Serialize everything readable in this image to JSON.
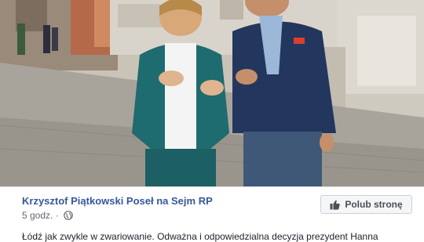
{
  "post": {
    "author": "Krzysztof Piątkowski Poseł na Sejm RP",
    "time": "5 godz. ·",
    "privacy_icon": "globe-icon",
    "like_button_label": "Polub stronę",
    "like_icon": "thumbs-up-icon",
    "text": "Łódź jak zwykle w zwariowanie. Odważna i odpowiedzialna decyzja prezydent Hanna"
  },
  "colors": {
    "author_link": "#365899",
    "meta_text": "#616770",
    "button_border": "#ccd0d5",
    "button_bg": "#f5f6f7"
  }
}
